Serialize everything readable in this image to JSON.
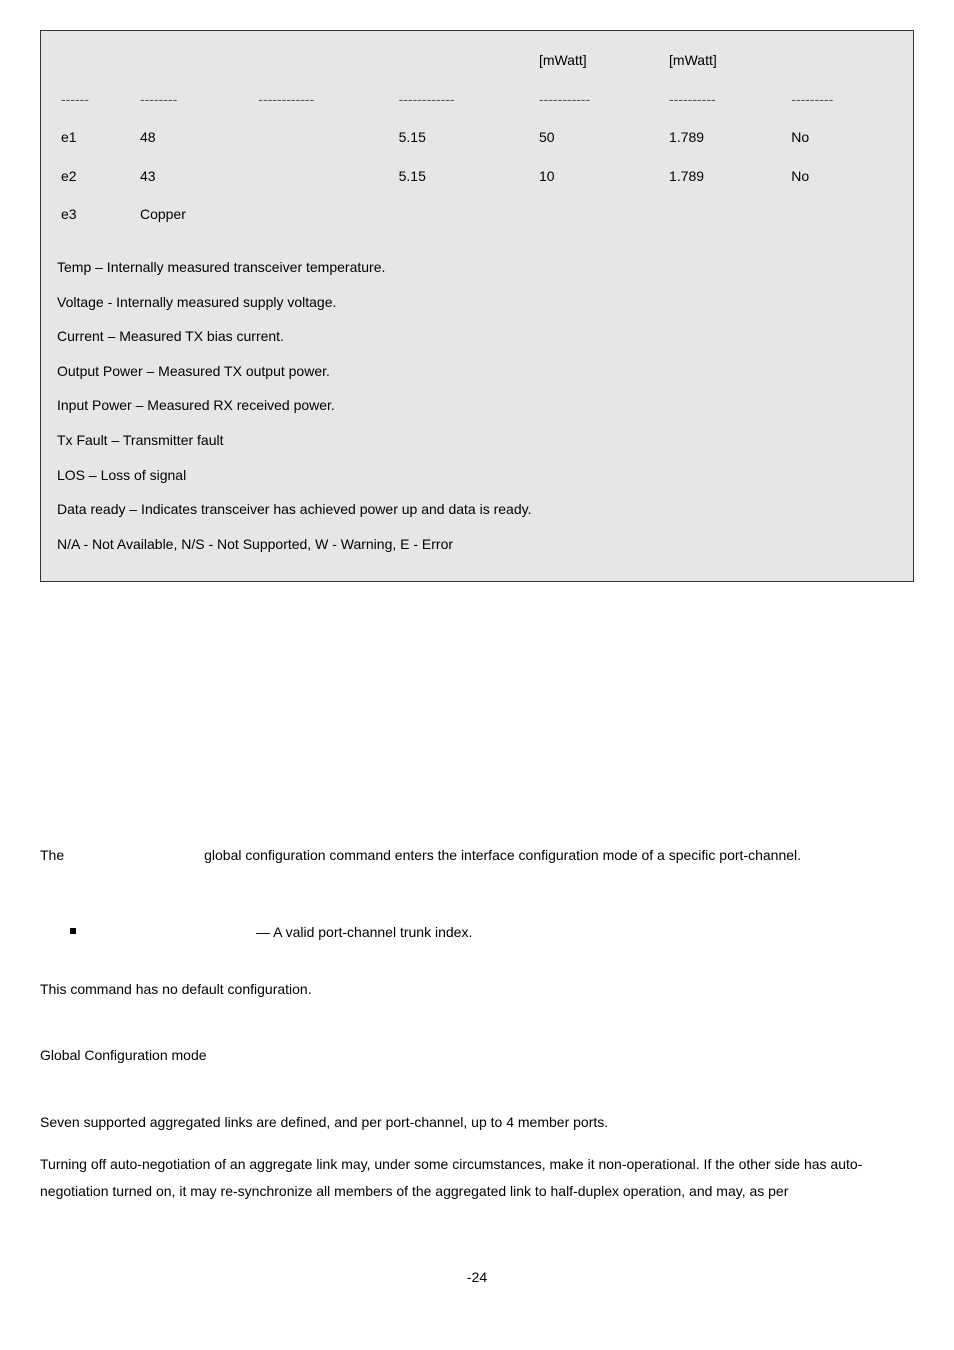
{
  "table": {
    "header": {
      "c1": "",
      "c2": "",
      "c3": "",
      "c4": "",
      "c5": "[mWatt]",
      "c6": "[mWatt]",
      "c7": ""
    },
    "dashes": {
      "c1": "------",
      "c2": "--------",
      "c3": "------------",
      "c4": "------------",
      "c5": "-----------",
      "c6": "----------",
      "c7": "---------"
    },
    "rows": [
      {
        "c1": "e1",
        "c2": "48",
        "c3": "",
        "c4": "5.15",
        "c5": "50",
        "c6": "1.789",
        "c7": "No"
      },
      {
        "c1": "e2",
        "c2": "43",
        "c3": "",
        "c4": "5.15",
        "c5": "10",
        "c6": "1.789",
        "c7": "No"
      },
      {
        "c1": "e3",
        "c2": "Copper",
        "c3": "",
        "c4": "",
        "c5": "",
        "c6": "",
        "c7": ""
      }
    ]
  },
  "notes": [
    "Temp – Internally measured transceiver temperature.",
    "Voltage - Internally measured supply voltage.",
    "Current – Measured TX bias current.",
    "Output Power – Measured TX output power.",
    "Input Power – Measured RX received power.",
    "Tx Fault – Transmitter fault",
    "LOS – Loss of signal",
    "Data ready – Indicates transceiver has achieved power up and data is ready.",
    "N/A - Not Available, N/S - Not Supported, W - Warning, E - Error"
  ],
  "intro": {
    "prefix": "The",
    "rest": "global configuration command enters the interface configuration mode of a specific port-channel."
  },
  "bullet": "— A valid port-channel trunk index.",
  "default_cfg": "This command has no default configuration.",
  "mode": "Global Configuration mode",
  "guide1": "Seven supported aggregated links are defined, and per port-channel, up to 4 member ports.",
  "guide2": "Turning off auto-negotiation of an aggregate link may, under some circumstances, make it non-operational. If the other side has auto-negotiation turned on, it may re-synchronize all members of the aggregated link to half-duplex operation, and may, as per",
  "page_no": "-24"
}
